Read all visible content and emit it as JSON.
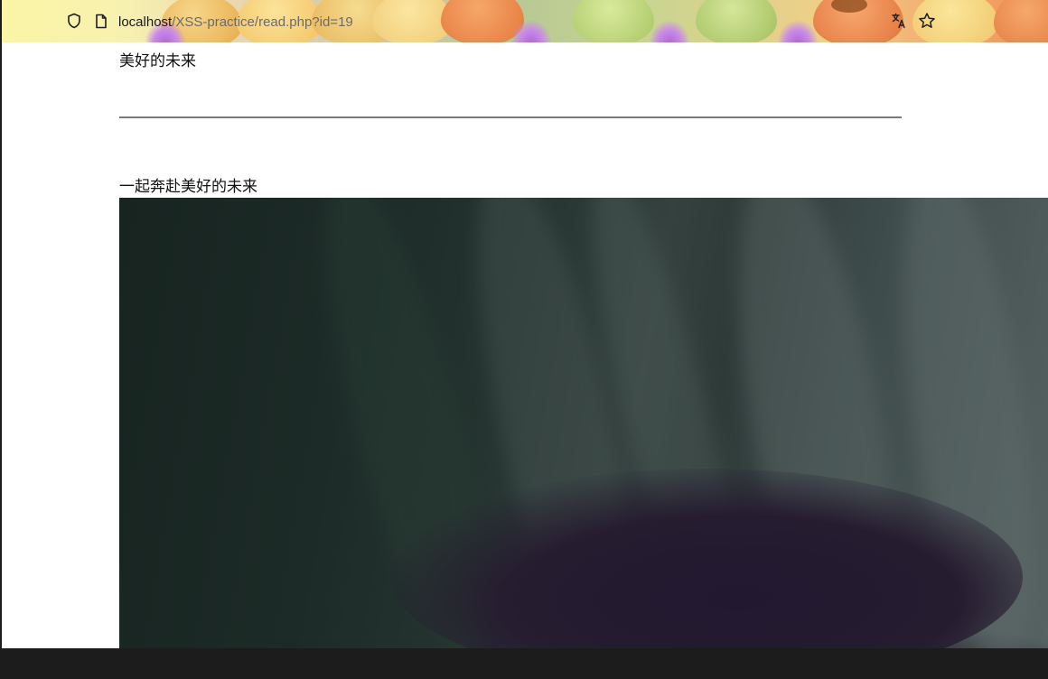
{
  "browser": {
    "url_host": "localhost",
    "url_path": "/XSS-practice/read.php?id=19",
    "icons": {
      "shield": "tracking-protection-shield-icon",
      "page": "page-info-icon",
      "translate": "translate-icon",
      "bookmark": "bookmark-star-icon"
    },
    "theme_colors": [
      "#fbf5a6",
      "#f3a86b",
      "#b8c994",
      "#c98ae6"
    ]
  },
  "page": {
    "heading": "美好的未来",
    "body_text": "一起奔赴美好的未来",
    "image": "post-photo",
    "background": "#ffffff"
  }
}
